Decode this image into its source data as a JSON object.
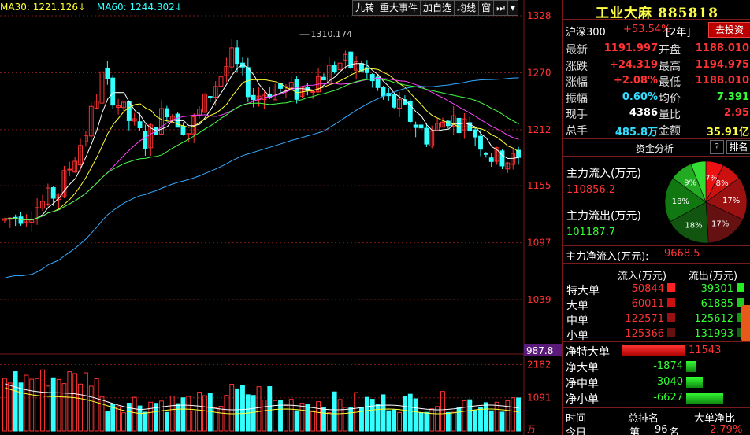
{
  "ma_bar": {
    "ma30": "MA30: 1221.126",
    "ma60": "MA60: 1244.302",
    "arrow": "↓"
  },
  "toolbar": {
    "items": [
      "九转",
      "重大事件",
      "加自选",
      "均线",
      "窗"
    ],
    "icon_next": "⏭",
    "icon_menu": "▾"
  },
  "price_axis": {
    "labels": [
      "1328",
      "1270",
      "1212",
      "1155",
      "1097",
      "1039"
    ],
    "current": "987.8"
  },
  "volume_axis": {
    "labels": [
      "2182",
      "1091"
    ],
    "unit": "万"
  },
  "annotation": {
    "peak": "1310.174"
  },
  "stock": {
    "name": "工业大麻",
    "code": "885818"
  },
  "index_row": {
    "name": "沪深300",
    "change": "+53.54%",
    "period": "[2年]",
    "button": "去投资"
  },
  "quote": [
    {
      "l1": "最新",
      "v1": "1191.997",
      "l2": "开盘",
      "v2": "1188.010"
    },
    {
      "l1": "涨跌",
      "v1": "+24.319",
      "l2": "最高",
      "v2": "1194.975"
    },
    {
      "l1": "涨幅",
      "v1": "+2.08%",
      "l2": "最低",
      "v2": "1188.010"
    },
    {
      "l1": "振幅",
      "v1": "0.60%",
      "l2": "均价",
      "v2": "7.391"
    },
    {
      "l1": "现手",
      "v1": "4386",
      "l2": "量比",
      "v2": "2.95"
    },
    {
      "l1": "总手",
      "v1": "485.8万",
      "l2": "金额",
      "v2": "35.91亿"
    }
  ],
  "fund_analysis": {
    "tab": "资金分析",
    "help": "?",
    "rank": "排名"
  },
  "main_flow": {
    "in_label": "主力流入(万元)",
    "in_value": "110856.2",
    "out_label": "主力流出(万元)",
    "out_value": "101187.7",
    "net_label": "主力净流入(万元):",
    "net_value": "9668.5"
  },
  "pie": {
    "slices": [
      {
        "label": "7%",
        "value": 7,
        "color": "#ee1111"
      },
      {
        "label": "8%",
        "value": 8,
        "color": "#cc1111"
      },
      {
        "label": "17%",
        "value": 17,
        "color": "#991111"
      },
      {
        "label": "17%",
        "value": 17,
        "color": "#661111"
      },
      {
        "label": "18%",
        "value": 18,
        "color": "#115511"
      },
      {
        "label": "18%",
        "value": 18,
        "color": "#117711"
      },
      {
        "label": "9%",
        "value": 9,
        "color": "#22aa22"
      },
      {
        "label": "",
        "value": 6,
        "color": "#33dd33"
      }
    ]
  },
  "flow_table": {
    "headers": [
      "流入(万元)",
      "流出(万元)"
    ],
    "rows": [
      {
        "label": "特大单",
        "in": "50844",
        "out": "39301",
        "in_color": "#ff2222",
        "out_color": "#22ee22"
      },
      {
        "label": "大单",
        "in": "60011",
        "out": "61885",
        "in_color": "#cc1111",
        "out_color": "#22cc22"
      },
      {
        "label": "中单",
        "in": "122571",
        "out": "125612",
        "in_color": "#991111",
        "out_color": "#119911"
      },
      {
        "label": "小单",
        "in": "125366",
        "out": "131993",
        "in_color": "#661111",
        "out_color": "#116611"
      }
    ]
  },
  "net_flow": {
    "rows": [
      {
        "label": "净特大单",
        "value": "11543",
        "fill": 0.74,
        "dir": "pos"
      },
      {
        "label": "净大单",
        "value": "-1874",
        "fill": 0.12,
        "dir": "neg"
      },
      {
        "label": "净中单",
        "value": "-3040",
        "fill": 0.19,
        "dir": "neg"
      },
      {
        "label": "净小单",
        "value": "-6627",
        "fill": 0.43,
        "dir": "neg"
      }
    ]
  },
  "bottom": {
    "h1": "时间",
    "h2": "总排名",
    "h3": "大单净比",
    "r1": "今日",
    "r2a": "第",
    "r2b": "96",
    "r2c": "名",
    "r3": "2.79%"
  },
  "colors": {
    "up": "#ff3333",
    "down": "#33ffff",
    "ma5": "#ffffff",
    "ma10": "#ffff33",
    "ma20": "#ff44ff",
    "ma30": "#44ff44",
    "ma60": "#33aaff",
    "grid": "#7a1a1a"
  }
}
